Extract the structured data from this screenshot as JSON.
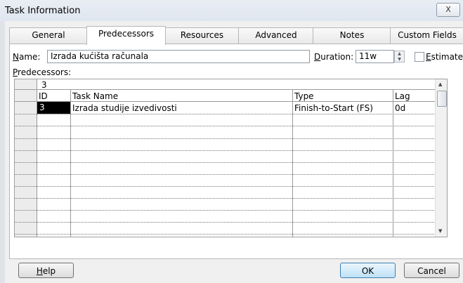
{
  "window": {
    "title": "Task Information",
    "close_label": "X"
  },
  "tabs": [
    {
      "label": "General"
    },
    {
      "label": "Predecessors"
    },
    {
      "label": "Resources"
    },
    {
      "label": "Advanced"
    },
    {
      "label": "Notes"
    },
    {
      "label": "Custom Fields"
    }
  ],
  "form": {
    "name_label_u": "N",
    "name_label_rest": "ame:",
    "name_value": "Izrada kućišta računala",
    "duration_label_u": "D",
    "duration_label_rest": "uration:",
    "duration_value": "11w",
    "estimated_label_u": "E",
    "estimated_label_rest": "stimated",
    "predecessors_label_u": "P",
    "predecessors_label_rest": "redecessors:"
  },
  "table": {
    "edit_value": "3",
    "columns": {
      "id": "ID",
      "task_name": "Task Name",
      "type": "Type",
      "lag": "Lag"
    },
    "rows": [
      {
        "id": "3",
        "task_name": "Izrada studije izvedivosti",
        "type": "Finish-to-Start (FS)",
        "lag": "0d"
      }
    ]
  },
  "buttons": {
    "help_u": "H",
    "help_rest": "elp",
    "ok": "OK",
    "cancel": "Cancel"
  }
}
